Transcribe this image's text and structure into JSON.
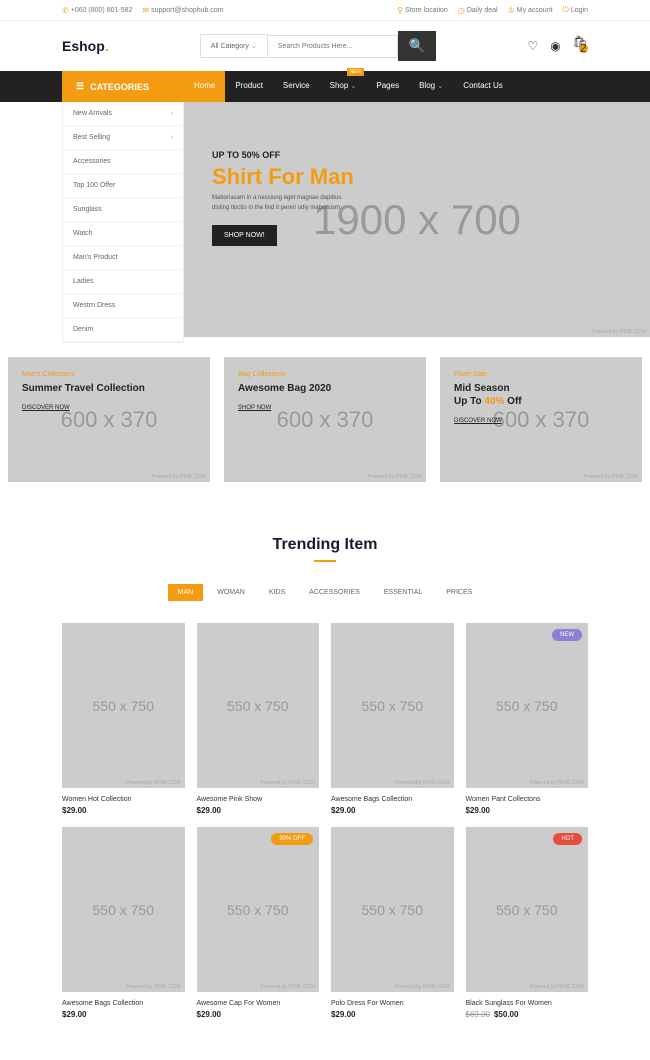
{
  "topbar": {
    "phone": "+060 (800) 801-582",
    "email": "support@shophub.com",
    "store": "Store location",
    "deal": "Daily deal",
    "account": "My account",
    "login": "Login"
  },
  "logo": {
    "a": "Eshop",
    "b": "."
  },
  "search": {
    "cat": "All Category",
    "placeholder": "Search Products Here..."
  },
  "cart_count": "2",
  "cat_label": "CATEGORIES",
  "cats": [
    "New Arrivals",
    "Best Selling",
    "Accessories",
    "Top 100 Offer",
    "Sunglass",
    "Watch",
    "Man's Product",
    "Ladies",
    "Westrn Dress",
    "Denim"
  ],
  "nav": [
    "Home",
    "Product",
    "Service",
    "Shop",
    "Pages",
    "Blog",
    "Contact Us"
  ],
  "nav_new": "NEW",
  "hero": {
    "off": "UP TO 50% OFF",
    "title": "Shirt For Man",
    "desc": "Maboriasam in a nesciung eget magnae dapibus disting tloctio in the find it pereri odiy maboriosm.",
    "btn": "SHOP NOW!",
    "ph": "1900 x 700"
  },
  "banners": [
    {
      "cat": "Man's Collectons",
      "title": "Summer Travel Collection",
      "link": "DISCOVER NOW",
      "ph": "600 x 370"
    },
    {
      "cat": "Bag Collectons",
      "title": "Awesome Bag 2020",
      "link": "SHOP NOW",
      "ph": "600 x 370"
    },
    {
      "cat": "Flash Sale",
      "title_a": "Mid Season",
      "title_b": "Up To ",
      "title_c": "40%",
      "title_d": " Off",
      "link": "DISCOVER NOW",
      "ph": "600 x 370"
    }
  ],
  "trending": "Trending Item",
  "tabs": [
    "MAN",
    "WOMAN",
    "KIDS",
    "ACCESSORIES",
    "ESSENTIAL",
    "PRICES"
  ],
  "products": [
    {
      "name": "Women Hot Collection",
      "price": "$29.00",
      "ph": "550 x 750"
    },
    {
      "name": "Awesome Pink Show",
      "price": "$29.00",
      "ph": "550 x 750"
    },
    {
      "name": "Awesome Bags Collection",
      "price": "$29.00",
      "ph": "550 x 750"
    },
    {
      "name": "Women Pant Collectons",
      "price": "$29.00",
      "ph": "550 x 750",
      "badge": "NEW",
      "bcls": "bg-new"
    },
    {
      "name": "Awesome Bags Collection",
      "price": "$29.00",
      "ph": "550 x 750"
    },
    {
      "name": "Awesome Cap For Women",
      "price": "$29.00",
      "ph": "550 x 750",
      "badge": "30% OFF",
      "bcls": "bg-off"
    },
    {
      "name": "Polo Dress For Women",
      "price": "$29.00",
      "ph": "550 x 750"
    },
    {
      "name": "Black Sunglass For Women",
      "price": "$50.00",
      "old": "$69.00",
      "ph": "550 x 750",
      "badge": "HOT",
      "bcls": "bg-hot"
    }
  ],
  "wm": "Powered by HTML.COM"
}
